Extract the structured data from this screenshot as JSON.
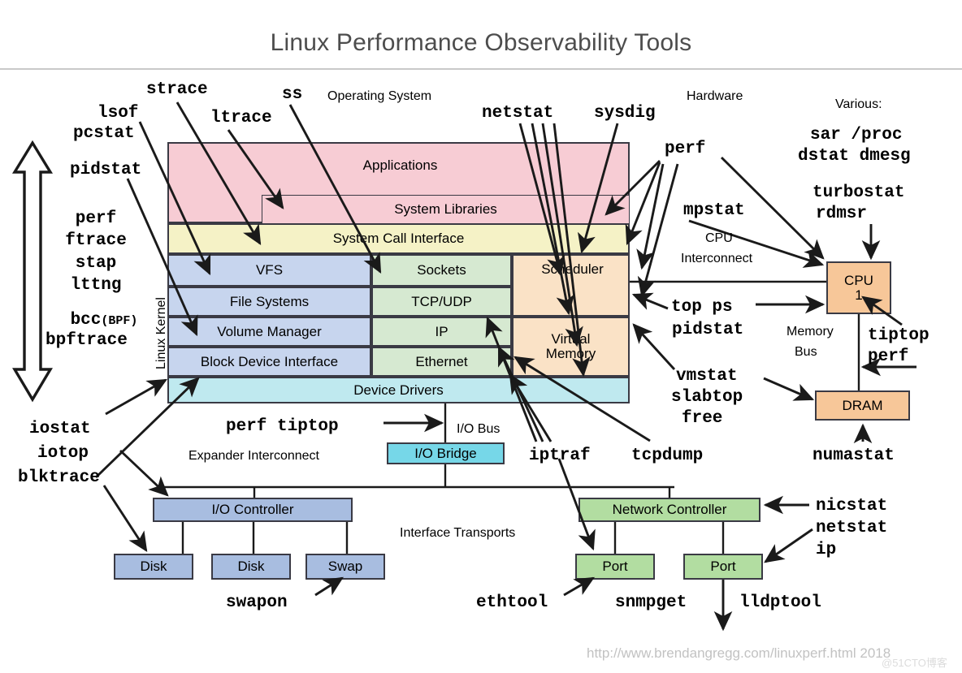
{
  "title": "Linux Performance Observability Tools",
  "section_labels": {
    "operating_system": "Operating System",
    "hardware": "Hardware",
    "various": "Various:",
    "linux_kernel": "Linux Kernel",
    "cpu_interconnect_l1": "CPU",
    "cpu_interconnect_l2": "Interconnect",
    "memory_bus_l1": "Memory",
    "memory_bus_l2": "Bus",
    "io_bus": "I/O Bus",
    "expander_interconnect": "Expander Interconnect",
    "interface_transports": "Interface Transports"
  },
  "stack": {
    "applications": "Applications",
    "system_libraries": "System Libraries",
    "system_call_interface": "System Call Interface",
    "vfs": "VFS",
    "file_systems": "File Systems",
    "volume_manager": "Volume Manager",
    "block_device_interface": "Block Device Interface",
    "sockets": "Sockets",
    "tcp_udp": "TCP/UDP",
    "ip": "IP",
    "ethernet": "Ethernet",
    "scheduler": "Scheduler",
    "virtual_memory_l1": "Virtual",
    "virtual_memory_l2": "Memory",
    "device_drivers": "Device Drivers"
  },
  "hardware": {
    "cpu_l1": "CPU",
    "cpu_l2": "1",
    "dram": "DRAM",
    "io_bridge": "I/O Bridge",
    "io_controller": "I/O Controller",
    "disk1": "Disk",
    "disk2": "Disk",
    "swap": "Swap",
    "network_controller": "Network Controller",
    "port1": "Port",
    "port2": "Port"
  },
  "tools": {
    "strace": "strace",
    "ss": "ss",
    "lsof": "lsof",
    "pcstat": "pcstat",
    "ltrace": "ltrace",
    "netstat_top": "netstat",
    "sysdig": "sysdig",
    "pidstat_left": "pidstat",
    "perf_top_right": "perf",
    "mpstat": "mpstat",
    "sar_proc": "sar /proc",
    "dstat_dmesg": "dstat dmesg",
    "turbostat": "turbostat",
    "rdmsr": "rdmsr",
    "kernel_tools": "perf\nftrace\nstap\nlttng",
    "bcc": "bcc",
    "bcc_bpf": "(BPF)",
    "bpftrace": "bpftrace",
    "top_ps": "top ps",
    "pidstat_cpu": "pidstat",
    "tiptop": "tiptop",
    "perf_mem": "perf",
    "vmstat": "vmstat",
    "slabtop": "slabtop",
    "free": "free",
    "numastat": "numastat",
    "iostat": "iostat",
    "iotop": "iotop",
    "blktrace": "blktrace",
    "perf_tiptop": "perf tiptop",
    "iptraf": "iptraf",
    "tcpdump": "tcpdump",
    "swapon": "swapon",
    "ethtool": "ethtool",
    "snmpget": "snmpget",
    "lldptool": "lldptool",
    "nicstat": "nicstat",
    "netstat_nic": "netstat",
    "ip": "ip"
  },
  "footer": "http://www.brendangregg.com/linuxperf.html 2018",
  "watermark": "@51CTO博客",
  "colors": {
    "pink": "#f7ccd4",
    "yellow": "#f5f2c6",
    "blue": "#c7d5ee",
    "green": "#d6e9d1",
    "orange": "#fae2c6",
    "cyan": "#bfe9ef",
    "hw_blue": "#a8bde0",
    "hw_green": "#b2dda1",
    "hw_cyan": "#76d7e8",
    "hw_orange": "#f7c799",
    "title_gray": "#4d4d4d",
    "footer_gray": "#c2c2c2"
  }
}
